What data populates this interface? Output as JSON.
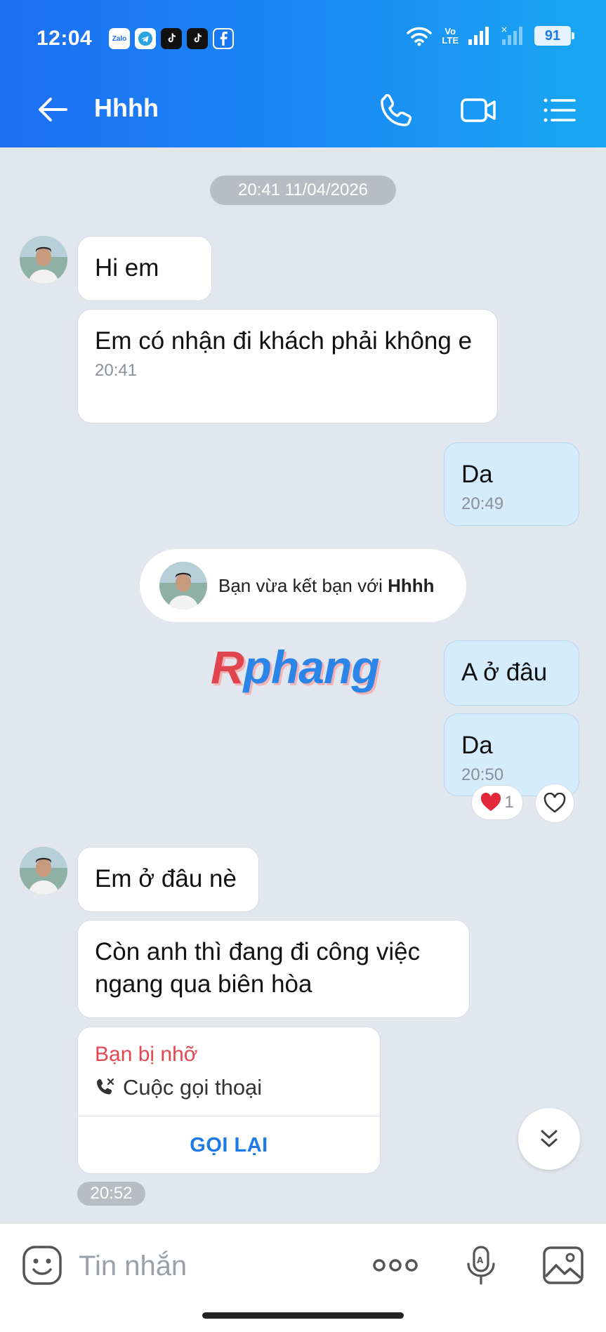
{
  "status_bar": {
    "time": "12:04",
    "notification_apps": [
      "zalo-icon",
      "telegram-icon",
      "tiktok-icon",
      "tiktok-icon",
      "facebook-icon"
    ],
    "zalo_text": "Zalo",
    "volte_top": "Vo",
    "volte_bottom": "LTE",
    "battery": "91"
  },
  "header": {
    "title": "Hhhh",
    "accent_gradient": [
      "#1d6ff2",
      "#19a8f2"
    ]
  },
  "conversation": {
    "date_separator": "20:41 11/04/2026",
    "msg1": {
      "text": "Hi em"
    },
    "msg2": {
      "text": "Em có nhận đi khách phải không e",
      "time": "20:41"
    },
    "msg3": {
      "text": "Da",
      "time": "20:49"
    },
    "system_notice": {
      "prefix": "Bạn vừa kết bạn với ",
      "name": "Hhhh"
    },
    "watermark": {
      "first": "R",
      "rest": "phang"
    },
    "msg4": {
      "text": "A ở đâu"
    },
    "msg5": {
      "text": "Da",
      "time": "20:50"
    },
    "reaction": {
      "emoji": "❤️",
      "count": "1"
    },
    "msg6": {
      "text": "Em ở đâu nè"
    },
    "msg7": {
      "text": "Còn anh thì đang đi công việc ngang qua biên hòa"
    },
    "missed_call": {
      "status": "Bạn bị nhỡ",
      "type": "Cuộc gọi thoại",
      "action": "GỌI LẠI",
      "time": "20:52"
    }
  },
  "composer": {
    "placeholder": "Tin nhắn"
  },
  "colors": {
    "chat_bg": "#e2e6ee",
    "my_bubble": "#d4ecfc",
    "missed_red": "#e5474f",
    "link_blue": "#1b7ae6"
  }
}
